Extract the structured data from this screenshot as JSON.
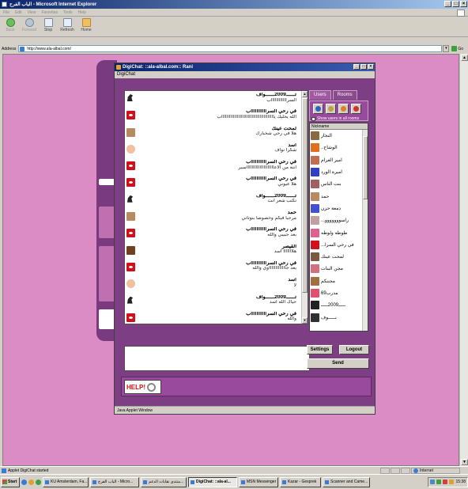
{
  "browser": {
    "title": "ﺍﻟﺒﺎﺏ ﺍﻟﻔﺮﺡ - Microsoft Internet Explorer",
    "menu": [
      "File",
      "Edit",
      "View",
      "Favorites",
      "Tools",
      "Help"
    ],
    "toolbar": {
      "back": "Back",
      "forward": "Forward",
      "stop": "Stop",
      "refresh": "Refresh",
      "home": "Home"
    },
    "address_label": "Address",
    "address_value": "http://www.ala-albal.com/",
    "go_label": "Go",
    "status_text": "Applet DigiChat started",
    "zone_label": "Internet"
  },
  "taskbar": {
    "start_label": "Start",
    "tasks": [
      {
        "label": "KU Amsterdam, Fa..."
      },
      {
        "label": "ﺍﻟﺒﺎﺏ ﺍﻟﻔﺮﺡ - Micro..."
      },
      {
        "label": "ﻣﻨﺘﺪﻯ ﻧﻘﺎﺑﺎﺕ ﺍﻟﺪﻋﻢ..."
      },
      {
        "label": "DigiChat: ::ala-al..."
      },
      {
        "label": "MSN Messenger"
      },
      {
        "label": "Kazar - Gesprek"
      },
      {
        "label": "Scanner and Came..."
      }
    ],
    "clock": "15:38"
  },
  "chat": {
    "window_title": "DigiChat: ::ala-albal.com:: Rani",
    "subtitle": "DigiChat",
    "status_bar": "Java Applet Window",
    "messages": [
      {
        "nick": "ﺗــــــ2009ــــــﻮﺍﻑ",
        "text": "ﺍﻟﺴﺮﺍﺍﺍﺍﺍﺍﺍﺍﺍﺍﺍﺍﺏ",
        "avatar": "horse"
      },
      {
        "nick": "ﻓﻲ ﺭﺣﻲ ﺍﻟﺴﺮﺍﺍﺍﺍﺍﺍﺍﺍﺍﺍﺍﺏ",
        "text": "ﺍﻟﻠﻪ ﻳﺨﻠﻴﻚ ﻳﺎﺍﺍﺍﺍﺍﺍﺍﺍﺍﺍﺍﺍﺍﺍﺍﺍﺍﺍﺍﺍﺍﺍﺍﺍﺍﺍﺍﺍﺍﺍﺍﺍﺍﺍﺍﺍﺍﺍﺍﺏ",
        "avatar": "red"
      },
      {
        "nick": "ﻟﻤﺤﺖ ﻋﻴﻨﻚ",
        "text": "ﻫﻼ ﻓﻲ ﺭﺣﻲ ﺷﺨﺒﺎﺭﻙ",
        "avatar": "photo"
      },
      {
        "nick": "ﺍﺳﺪ",
        "text": "ﺷﻜﺮﺍ ﺗﻮﺍﻑ",
        "avatar": "cupid"
      },
      {
        "nick": "ﻓﻲ ﺭﺣﻲ ﺍﻟﺴﺮﺍﺍﺍﺍﺍﺍﺍﺍﺍﺍﺍﺏ",
        "text": "ﺍﻧﺘﻪ ﻣﻦ ﺍﻻﻋﺎﺍﺍﺍﺍﺍﺍﺍﺍﺍﺍﺍﺍﺍﺍﺍﺍﺍﺍﺍﺍﺳﻴﺮ",
        "avatar": "red"
      },
      {
        "nick": "ﻓﻲ ﺭﺣﻲ ﺍﻟﺴﺮﺍﺍﺍﺍﺍﺍﺍﺍﺍﺍﺍﺏ",
        "text": "ﻫﻼ ﻋﻴﻮﻧﻲ",
        "avatar": "red"
      },
      {
        "nick": "ﺗــــــ2009ــــــﻮﺍﻑ",
        "text": "ﺗﻜﺘﺐ ﺷﻌﺮ ﺍﻧﺖ",
        "avatar": "horse"
      },
      {
        "nick": "ﺣﻤﺪ",
        "text": "ﻣﺮﺣﺒﺎ ﻓﻴﻜﻢ ﻭﺧﺼﻮﺻﺎ ﺑﻨﻮﺗﺎﺗﻲ",
        "avatar": "photo"
      },
      {
        "nick": "ﻓﻲ ﺭﺣﻲ ﺍﻟﺴﺮﺍﺍﺍﺍﺍﺍﺍﺍﺍﺍﺍﺏ",
        "text": "ﺑﻌﺪ ﺣﺒﻴﺒﻲ ﻭﺍﻟﻠﻪ",
        "avatar": "red"
      },
      {
        "nick": "ﺍﻟﻘﻴﺼﺮ",
        "text": "ﻫﻼﺍﺍﺍﺍﺍﺍ ﺍﺳﺪ",
        "avatar": "man"
      },
      {
        "nick": "ﻓﻲ ﺭﺣﻲ ﺍﻟﺴﺮﺍﺍﺍﺍﺍﺍﺍﺍﺍﺍﺍﺏ",
        "text": "ﻳﻌﺪ ﺟﺎﺍﺍﺍﺍﺍﺍﺍﺍﺍﺍﺍﺍﻭﻱ ﻭﺍﻟﻠﻪ",
        "avatar": "red"
      },
      {
        "nick": "ﺍﺳﺪ",
        "text": "ﻻ",
        "avatar": "cupid"
      },
      {
        "nick": "ﺗــــــ2009ــــــﻮﺍﻑ",
        "text": "ﺣﻴﺎﻙ ﺍﻟﻠﻪ ﺍﺳﺪ",
        "avatar": "horse"
      },
      {
        "nick": "ﻓﻲ ﺭﺣﻲ ﺍﻟﺴﺮﺍﺍﺍﺍﺍﺍﺍﺍﺍﺍﺍﺏ",
        "text": "ﻭﺍﻟﻠﻪ",
        "avatar": "red"
      }
    ],
    "tabs": {
      "users": "Users",
      "rooms": "Rooms"
    },
    "show_all_label": "Show users in all rooms",
    "list_header": "Nickname",
    "users": [
      {
        "name": "ﺍﻟﻨﺠﺎﺭ",
        "color": "#8a6a40"
      },
      {
        "name": "ﺍﻟﻮﺷﺎﺡ..",
        "color": "#e07020"
      },
      {
        "name": "ﺍﻣﻴﺮ ﺍﻟﻐﺮﺍﻡ",
        "color": "#c07050"
      },
      {
        "name": "ﺍﻣﻴﺮﺓ ﺍﻟﻮﺭﺩ",
        "color": "#3040c0"
      },
      {
        "name": "ﺑﻨﺖ ﺍﻟﻨﺎﺱ",
        "color": "#a06060"
      },
      {
        "name": "ﺣﻤﺪ",
        "color": "#b88a60"
      },
      {
        "name": "ﺩﻣﻌﺔ ﺣﺰﻥ",
        "color": "#4050d0"
      },
      {
        "name": "ﺭﺍﺳﻮﻭﻭﻭﻭﻭﻭ...",
        "color": "#c0a0a0"
      },
      {
        "name": "ﻃﻮﻃﻪ ﻭﻟﻮﻃﻪ",
        "color": "#e06090"
      },
      {
        "name": "ﻓﻲ ﺭﺣﻲ ﺍﻟﺴﺮﺍ...",
        "color": "#d0101a"
      },
      {
        "name": "ﻟﻤﺤﺖ ﻋﻴﻨﻚ",
        "color": "#7a5a40"
      },
      {
        "name": "ﻣﺠﻦ ﺍﻟﺒﻨﺎﺕ",
        "color": "#d07080"
      },
      {
        "name": "ﻣﺠﻨﻨﻜﻢ",
        "color": "#a07040"
      },
      {
        "name": "ﻣﺪﺭﺏ69",
        "color": "#e05070"
      },
      {
        "name": "ـــــ2009ـــــ",
        "color": "#222222"
      },
      {
        "name": "ﻧـــــﻮﻑ",
        "color": "#303030"
      }
    ],
    "settings_label": "Settings",
    "logout_label": "Logout",
    "send_label": "Send",
    "help_label": "HELP!"
  }
}
